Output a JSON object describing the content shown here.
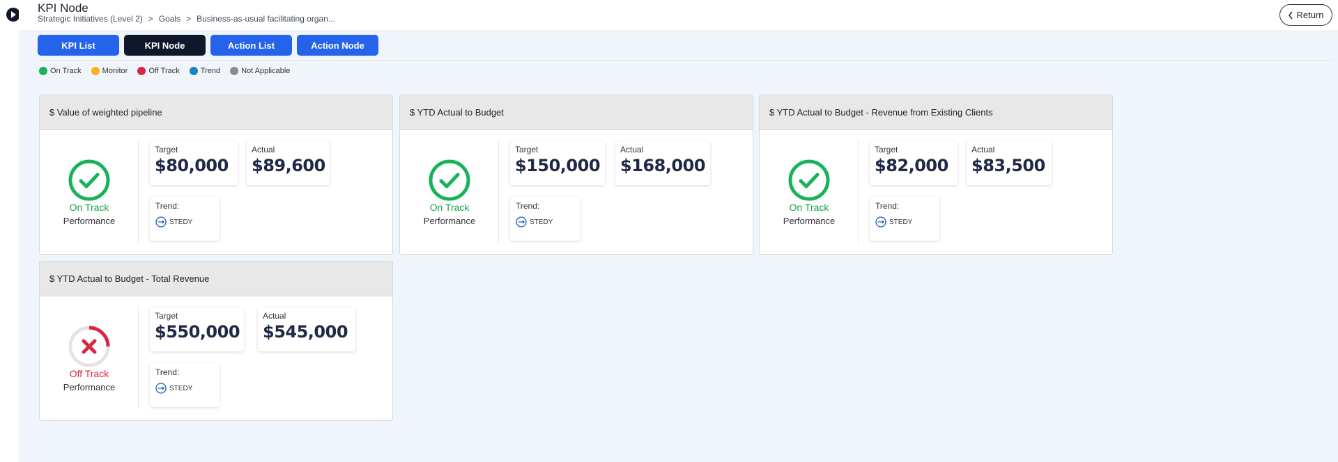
{
  "header": {
    "title": "KPI Node",
    "breadcrumb": [
      "Strategic Initiatives (Level 2)",
      "Goals",
      "Business-as-usual facilitating organ..."
    ],
    "return_label": "Return"
  },
  "tabs": [
    {
      "label": "KPI List",
      "active": false
    },
    {
      "label": "KPI Node",
      "active": true
    },
    {
      "label": "Action List",
      "active": false
    },
    {
      "label": "Action Node",
      "active": false
    }
  ],
  "legend": [
    {
      "label": "On Track",
      "color": "#16b358"
    },
    {
      "label": "Monitor",
      "color": "#f5b21b"
    },
    {
      "label": "Off Track",
      "color": "#dc2641"
    },
    {
      "label": "Trend",
      "color": "#1d7fc4"
    },
    {
      "label": "Not Applicable",
      "color": "#8a8a8a"
    }
  ],
  "colors": {
    "accent": "#2563eb",
    "active_tab": "#0f172a",
    "on_track": "#16a34a",
    "off_track": "#dc2641"
  },
  "kpis": [
    {
      "title": "$ Value of weighted pipeline",
      "status": "On Track",
      "status_type": "on-track",
      "performance_label": "Performance",
      "target_label": "Target",
      "target": "$80,000",
      "actual_label": "Actual",
      "actual": "$89,600",
      "trend_label": "Trend:",
      "trend": "STEDY"
    },
    {
      "title": "$ YTD Actual to Budget",
      "status": "On Track",
      "status_type": "on-track",
      "performance_label": "Performance",
      "target_label": "Target",
      "target": "$150,000",
      "actual_label": "Actual",
      "actual": "$168,000",
      "trend_label": "Trend:",
      "trend": "STEDY"
    },
    {
      "title": "$ YTD Actual to Budget - Revenue from Existing Clients",
      "status": "On Track",
      "status_type": "on-track",
      "performance_label": "Performance",
      "target_label": "Target",
      "target": "$82,000",
      "actual_label": "Actual",
      "actual": "$83,500",
      "trend_label": "Trend:",
      "trend": "STEDY"
    },
    {
      "title": "$ YTD Actual to Budget - Total Revenue",
      "status": "Off Track",
      "status_type": "off-track",
      "performance_label": "Performance",
      "target_label": "Target",
      "target": "$550,000",
      "actual_label": "Actual",
      "actual": "$545,000",
      "trend_label": "Trend:",
      "trend": "STEDY"
    }
  ]
}
